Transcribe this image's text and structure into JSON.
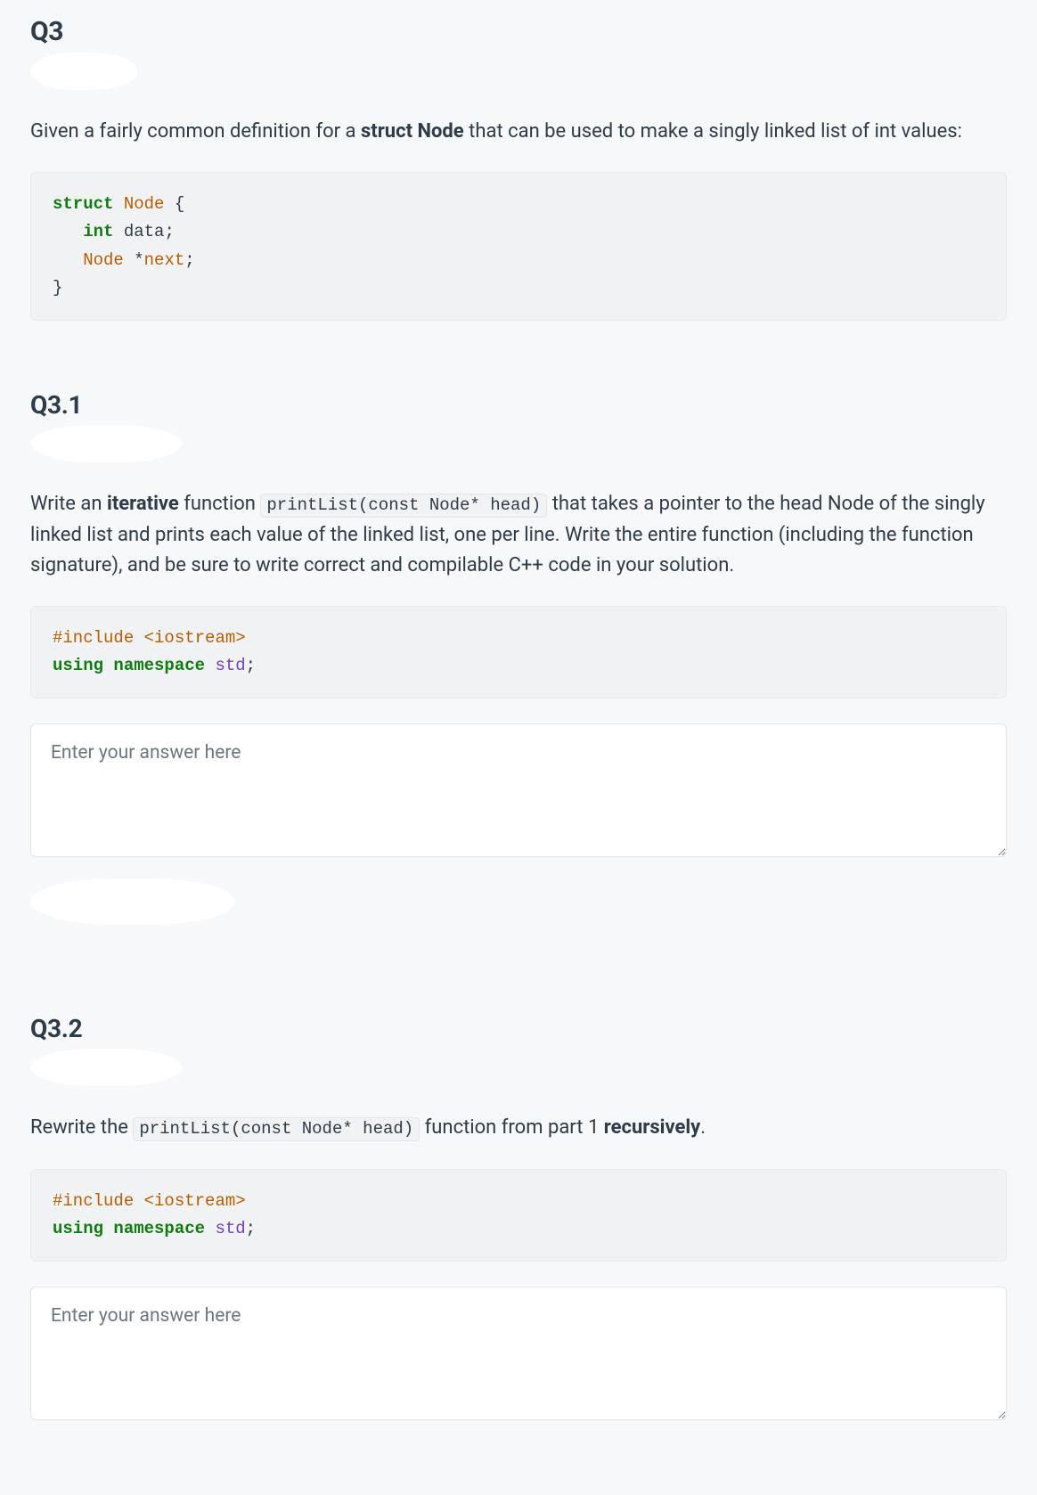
{
  "q3": {
    "title": "Q3",
    "intro_pre": "Given a fairly common definition for a ",
    "intro_bold": "struct Node",
    "intro_post": " that can be used to make a singly linked list of int values:",
    "code": {
      "l1_kw": "struct",
      "l1_type": "Node",
      "l1_brace": " {",
      "l2_indent": "   ",
      "l2_kw": "int",
      "l2_id": " data",
      "l2_end": ";",
      "l3_indent": "   ",
      "l3_type": "Node",
      "l3_ptr": " *",
      "l3_id": "next",
      "l3_end": ";",
      "l4_brace": "}"
    }
  },
  "q31": {
    "title": "Q3.1",
    "p_pre": "Write an ",
    "p_bold": "iterative",
    "p_mid1": " function ",
    "p_code": "printList(const Node* head)",
    "p_mid2": " that takes a pointer to the head Node of the singly linked list and prints each value of the linked list, one per line. Write the entire function (including the function signature), and be sure to write correct and compilable C++ code in your solution.",
    "code": {
      "l1_pre": "#include ",
      "l1_inc": "<iostream>",
      "l2_kw1": "using",
      "l2_sp1": " ",
      "l2_kw2": "namespace",
      "l2_sp2": " ",
      "l2_ns": "std",
      "l2_end": ";"
    },
    "placeholder": "Enter your answer here"
  },
  "q32": {
    "title": "Q3.2",
    "p_pre": "Rewrite the ",
    "p_code": "printList(const Node* head)",
    "p_mid": " function from part 1 ",
    "p_bold": "recursively",
    "p_end": ".",
    "code": {
      "l1_pre": "#include ",
      "l1_inc": "<iostream>",
      "l2_kw1": "using",
      "l2_sp1": " ",
      "l2_kw2": "namespace",
      "l2_sp2": " ",
      "l2_ns": "std",
      "l2_end": ";"
    },
    "placeholder": "Enter your answer here"
  }
}
